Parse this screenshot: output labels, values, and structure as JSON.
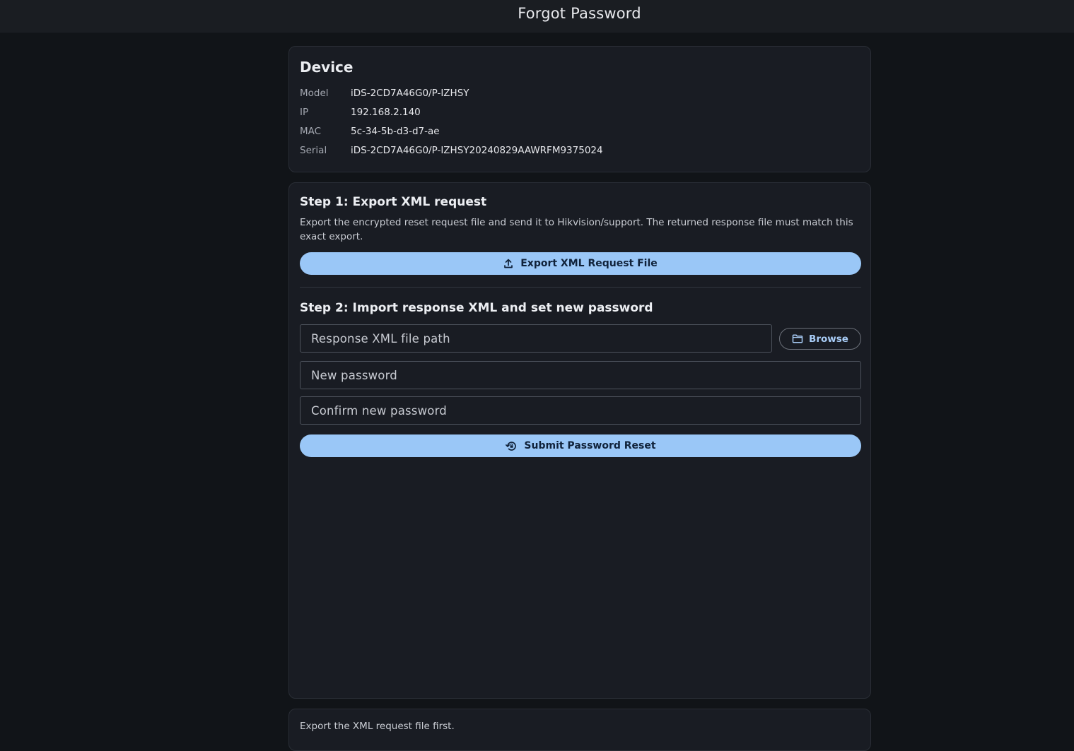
{
  "window": {
    "title": "Forgot Password"
  },
  "device": {
    "heading": "Device",
    "fields": [
      {
        "label": "Model",
        "value": "iDS-2CD7A46G0/P-IZHSY"
      },
      {
        "label": "IP",
        "value": "192.168.2.140"
      },
      {
        "label": "MAC",
        "value": "5c-34-5b-d3-d7-ae"
      },
      {
        "label": "Serial",
        "value": "iDS-2CD7A46G0/P-IZHSY20240829AAWRFM9375024"
      }
    ]
  },
  "step1": {
    "heading": "Step 1: Export XML request",
    "description": "Export the encrypted reset request file and send it to Hikvision/support. The returned response file must match this exact export.",
    "button_label": "Export XML Request File",
    "button_icon": "upload-icon"
  },
  "step2": {
    "heading": "Step 2: Import response XML and set new password",
    "response_path_placeholder": "Response XML file path",
    "browse_label": "Browse",
    "browse_icon": "folder-icon",
    "new_password_placeholder": "New password",
    "confirm_password_placeholder": "Confirm new password",
    "submit_label": "Submit Password Reset",
    "submit_icon": "lock-reset-icon"
  },
  "status": {
    "message": "Export the XML request file first."
  },
  "colors": {
    "background": "#111418",
    "card": "#191c23",
    "primary_button": "#9ac7f7",
    "primary_button_text": "#10223a",
    "outline_button_text": "#a8ccf6"
  }
}
